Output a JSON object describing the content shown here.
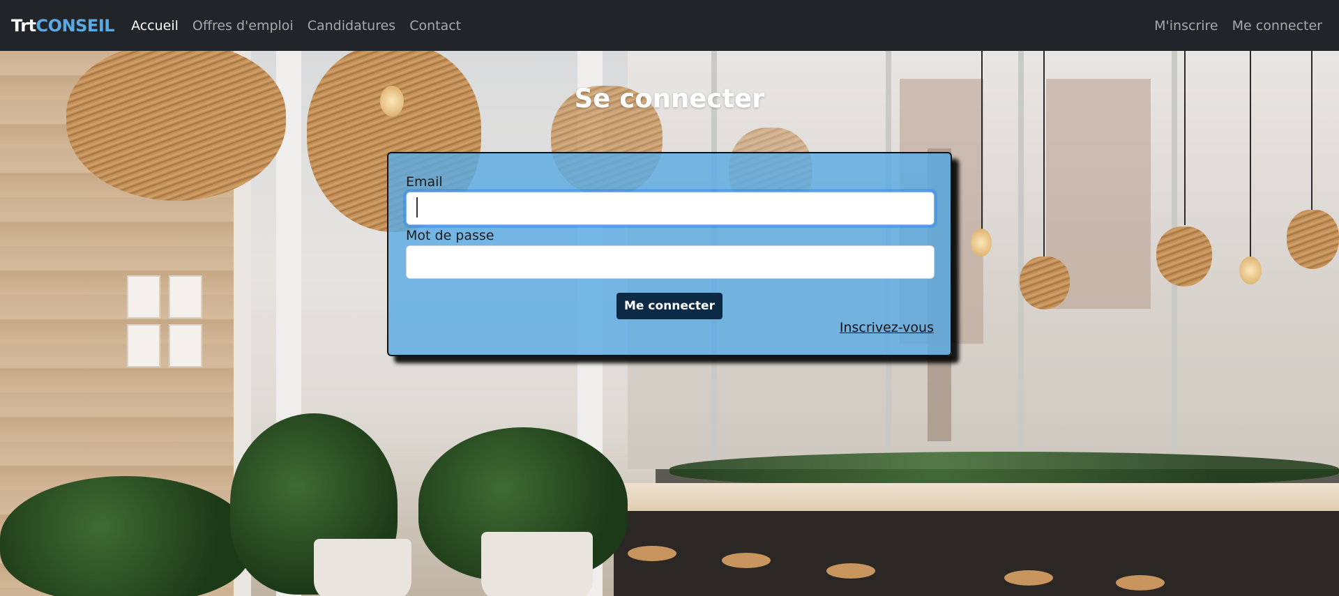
{
  "navbar": {
    "brand_part1": "Trt",
    "brand_part2": "CONSEIL",
    "links": [
      {
        "label": "Accueil",
        "active": true
      },
      {
        "label": "Offres d'emploi",
        "active": false
      },
      {
        "label": "Candidatures",
        "active": false
      },
      {
        "label": "Contact",
        "active": false
      }
    ],
    "right_links": [
      {
        "label": "M'inscrire"
      },
      {
        "label": "Me connecter"
      }
    ]
  },
  "page": {
    "title": "Se connecter"
  },
  "form": {
    "email_label": "Email",
    "email_value": "",
    "password_label": "Mot de passe",
    "password_value": "",
    "submit_label": "Me connecter",
    "register_link": "Inscrivez-vous"
  },
  "colors": {
    "navbar_bg": "#212529",
    "brand_accent": "#5aabe3",
    "card_bg": "#5aabe3",
    "button_bg": "#0c2a45"
  }
}
